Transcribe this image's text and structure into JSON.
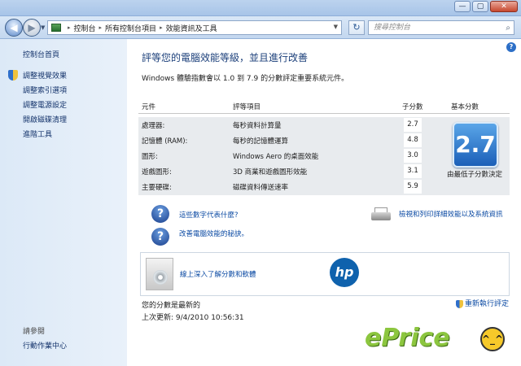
{
  "window": {
    "minimize_label": "—",
    "maximize_label": "▢",
    "close_label": "✕"
  },
  "nav": {
    "back_glyph": "◀",
    "forward_glyph": "▶",
    "breadcrumb": [
      "控制台",
      "所有控制台項目",
      "效能資訊及工具"
    ],
    "refresh_glyph": "↻",
    "search_placeholder": "搜尋控制台",
    "search_icon": "⌕"
  },
  "sidebar": {
    "home": "控制台首頁",
    "items": [
      "調整視覺效果",
      "調整索引選項",
      "調整電源設定",
      "開啟磁碟清理",
      "進階工具"
    ],
    "see_also_title": "請參閱",
    "see_also_items": [
      "行動作業中心"
    ]
  },
  "main": {
    "help_glyph": "?",
    "title": "評等您的電腦效能等級，並且進行改善",
    "subtitle": "Windows 體驗指數會以 1.0 到 7.9 的分數評定重要系統元件。",
    "table": {
      "headers": [
        "元件",
        "評等項目",
        "子分數",
        "基本分數"
      ],
      "rows": [
        {
          "component": "處理器:",
          "rating": "每秒資料計算量",
          "score": "2.7"
        },
        {
          "component": "記憶體 (RAM):",
          "rating": "每秒的記憶體運算",
          "score": "4.8"
        },
        {
          "component": "圖形:",
          "rating": "Windows Aero 的桌面效能",
          "score": "3.0"
        },
        {
          "component": "遊戲圖形:",
          "rating": "3D 商業和遊戲圖形效能",
          "score": "3.1"
        },
        {
          "component": "主要硬碟:",
          "rating": "磁碟資料傳送速率",
          "score": "5.9"
        }
      ],
      "base_score": "2.7",
      "base_caption": "由最低子分數決定"
    },
    "links": {
      "what_numbers": "這些數字代表什麼?",
      "tips": "改善電腦效能的秘訣。",
      "print": "檢視和列印詳細效能以及系統資訊"
    },
    "learn_more": "線上深入了解分數和軟體",
    "hp_logo": "hp",
    "footer": {
      "status": "您的分數是最新的",
      "last_update_label": "上次更新:",
      "last_update_value": "9/4/2010 10:56:31",
      "rerun": "重新執行評定"
    }
  },
  "watermark": {
    "text": "ePrice",
    "smiley": "^_^"
  }
}
